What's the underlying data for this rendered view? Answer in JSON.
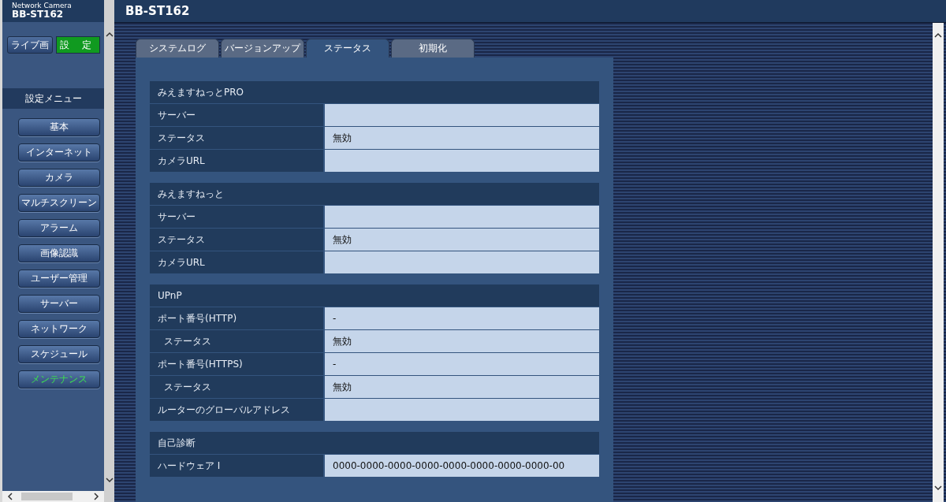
{
  "header": {
    "product": "Network Camera",
    "model": "BB-ST162",
    "title": "BB-ST162"
  },
  "mode_buttons": [
    {
      "label": "ライブ画",
      "selected": false
    },
    {
      "label": "設 定",
      "selected": true
    }
  ],
  "sidebar": {
    "title": "設定メニュー",
    "items": [
      {
        "label": "基本",
        "selected": false
      },
      {
        "label": "インターネット",
        "selected": false
      },
      {
        "label": "カメラ",
        "selected": false
      },
      {
        "label": "マルチスクリーン",
        "selected": false
      },
      {
        "label": "アラーム",
        "selected": false
      },
      {
        "label": "画像認識",
        "selected": false
      },
      {
        "label": "ユーザー管理",
        "selected": false
      },
      {
        "label": "サーバー",
        "selected": false
      },
      {
        "label": "ネットワーク",
        "selected": false
      },
      {
        "label": "スケジュール",
        "selected": false
      },
      {
        "label": "メンテナンス",
        "selected": true
      }
    ]
  },
  "tabs": [
    {
      "label": "システムログ",
      "selected": false
    },
    {
      "label": "バージョンアップ",
      "selected": false
    },
    {
      "label": "ステータス",
      "selected": true
    },
    {
      "label": "初期化",
      "selected": false
    }
  ],
  "sections": [
    {
      "title": "みえますねっとPRO",
      "rows": [
        {
          "label": "サーバー",
          "value": ""
        },
        {
          "label": "ステータス",
          "value": "無効"
        },
        {
          "label": "カメラURL",
          "value": ""
        }
      ]
    },
    {
      "title": "みえますねっと",
      "rows": [
        {
          "label": "サーバー",
          "value": ""
        },
        {
          "label": "ステータス",
          "value": "無効"
        },
        {
          "label": "カメラURL",
          "value": ""
        }
      ]
    },
    {
      "title": "UPnP",
      "rows": [
        {
          "label": "ポート番号(HTTP)",
          "value": "-"
        },
        {
          "label": "ステータス",
          "value": "無効",
          "indent": true
        },
        {
          "label": "ポート番号(HTTPS)",
          "value": "-"
        },
        {
          "label": "ステータス",
          "value": "無効",
          "indent": true
        },
        {
          "label": "ルーターのグローバルアドレス",
          "value": ""
        }
      ]
    },
    {
      "title": "自己診断",
      "rows": [
        {
          "label": "ハードウェア I",
          "value": "0000-0000-0000-0000-0000-0000-0000-0000-00"
        }
      ]
    }
  ]
}
